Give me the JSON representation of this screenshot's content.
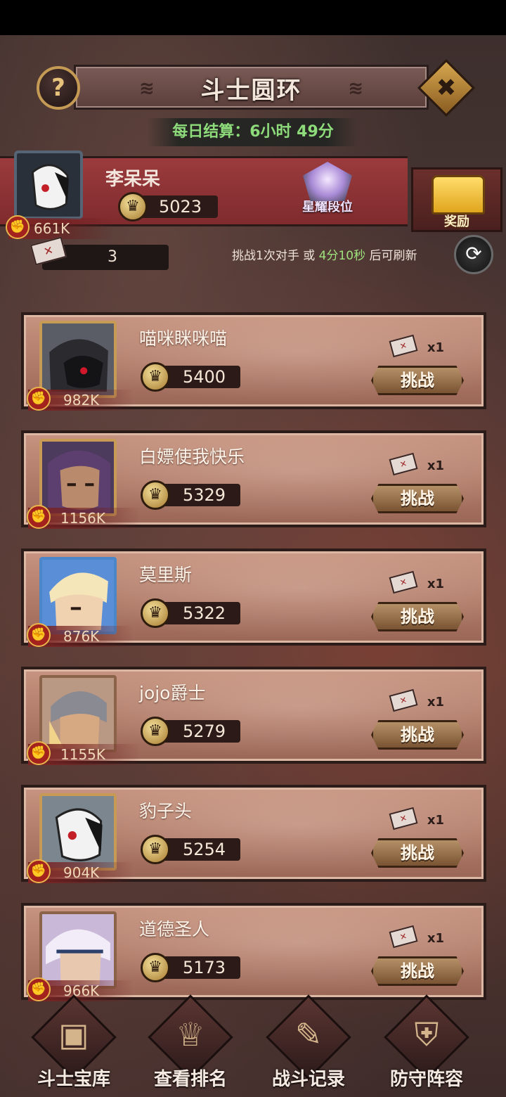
{
  "header": {
    "title": "斗士圆环",
    "help_label": "?",
    "close_label": "✖"
  },
  "daily_settlement": "每日结算：6小时 49分",
  "player": {
    "name": "李呆呆",
    "score": "5023",
    "power": "661K",
    "rank_label": "星耀段位",
    "reward_label": "奖励"
  },
  "tickets": {
    "count": "3"
  },
  "refresh": {
    "prefix": "挑战1次对手 或 ",
    "time": "4分10秒",
    "suffix": " 后可刷新"
  },
  "opponents": [
    {
      "name": "喵咪眯咪喵",
      "score": "5400",
      "power": "982K",
      "cost": "x1",
      "button": "挑战"
    },
    {
      "name": "白嫖使我快乐",
      "score": "5329",
      "power": "1156K",
      "cost": "x1",
      "button": "挑战"
    },
    {
      "name": "莫里斯",
      "score": "5322",
      "power": "876K",
      "cost": "x1",
      "button": "挑战"
    },
    {
      "name": "jojo爵士",
      "score": "5279",
      "power": "1155K",
      "cost": "x1",
      "button": "挑战"
    },
    {
      "name": "豹子头",
      "score": "5254",
      "power": "904K",
      "cost": "x1",
      "button": "挑战"
    },
    {
      "name": "道德圣人",
      "score": "5173",
      "power": "966K",
      "cost": "x1",
      "button": "挑战"
    }
  ],
  "bottom_nav": [
    {
      "label": "斗士宝库",
      "icon": "treasure-chest-icon"
    },
    {
      "label": "查看排名",
      "icon": "trophy-icon"
    },
    {
      "label": "战斗记录",
      "icon": "scroll-icon"
    },
    {
      "label": "防守阵容",
      "icon": "shield-icon"
    }
  ],
  "colors": {
    "timer_green": "#8ddb7a",
    "banner_red": "#9b3b3d",
    "card_tan": "#c69480",
    "gold": "#c79a56"
  }
}
